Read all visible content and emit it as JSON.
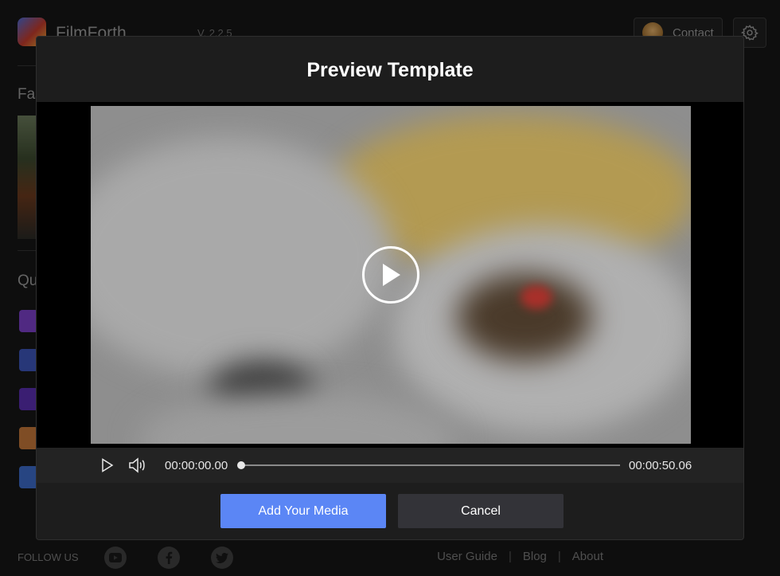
{
  "app": {
    "name": "FilmForth",
    "version": "V. 2.2.5",
    "contact_label": "Contact",
    "section_fast": "Fas",
    "section_quick": "Qu"
  },
  "footer": {
    "follow_label": "FOLLOW US",
    "links": [
      "User Guide",
      "Blog",
      "About"
    ],
    "separator": "|"
  },
  "modal": {
    "title": "Preview Template",
    "player": {
      "current_time": "00:00:00.00",
      "total_time": "00:00:50.06",
      "progress": 0.0
    },
    "primary_button": "Add Your Media",
    "secondary_button": "Cancel"
  },
  "colors": {
    "accent": "#5b86f5",
    "modal_bg": "#1d1d1d",
    "page_bg": "#161616"
  },
  "icons": [
    "play-icon",
    "volume-icon",
    "play-circle-icon",
    "gear-icon",
    "youtube-icon",
    "facebook-icon",
    "twitter-icon"
  ]
}
